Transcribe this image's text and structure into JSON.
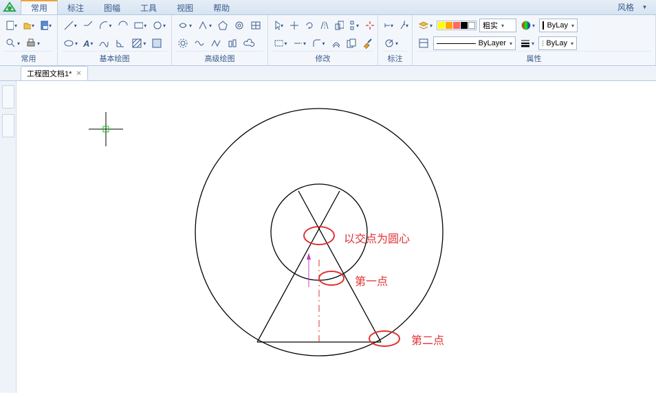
{
  "tabs": {
    "items": [
      "常用",
      "标注",
      "图幅",
      "工具",
      "视图",
      "帮助"
    ],
    "active": 0,
    "style_label": "风格"
  },
  "ribbon": {
    "groups": {
      "common": "常用",
      "basic_draw": "基本绘图",
      "adv_draw": "高级绘图",
      "modify": "修改",
      "annotate": "标注",
      "properties": "属性"
    },
    "props": {
      "lineweight_label": "粗实",
      "layer_combo": "ByLay",
      "linetype_combo": "ByLayer",
      "lineweight2": "ByLay"
    }
  },
  "doc": {
    "tab_title": "工程图文档1*"
  },
  "annotations": {
    "center": "以交点为圆心",
    "p1": "第一点",
    "p2": "第二点"
  }
}
